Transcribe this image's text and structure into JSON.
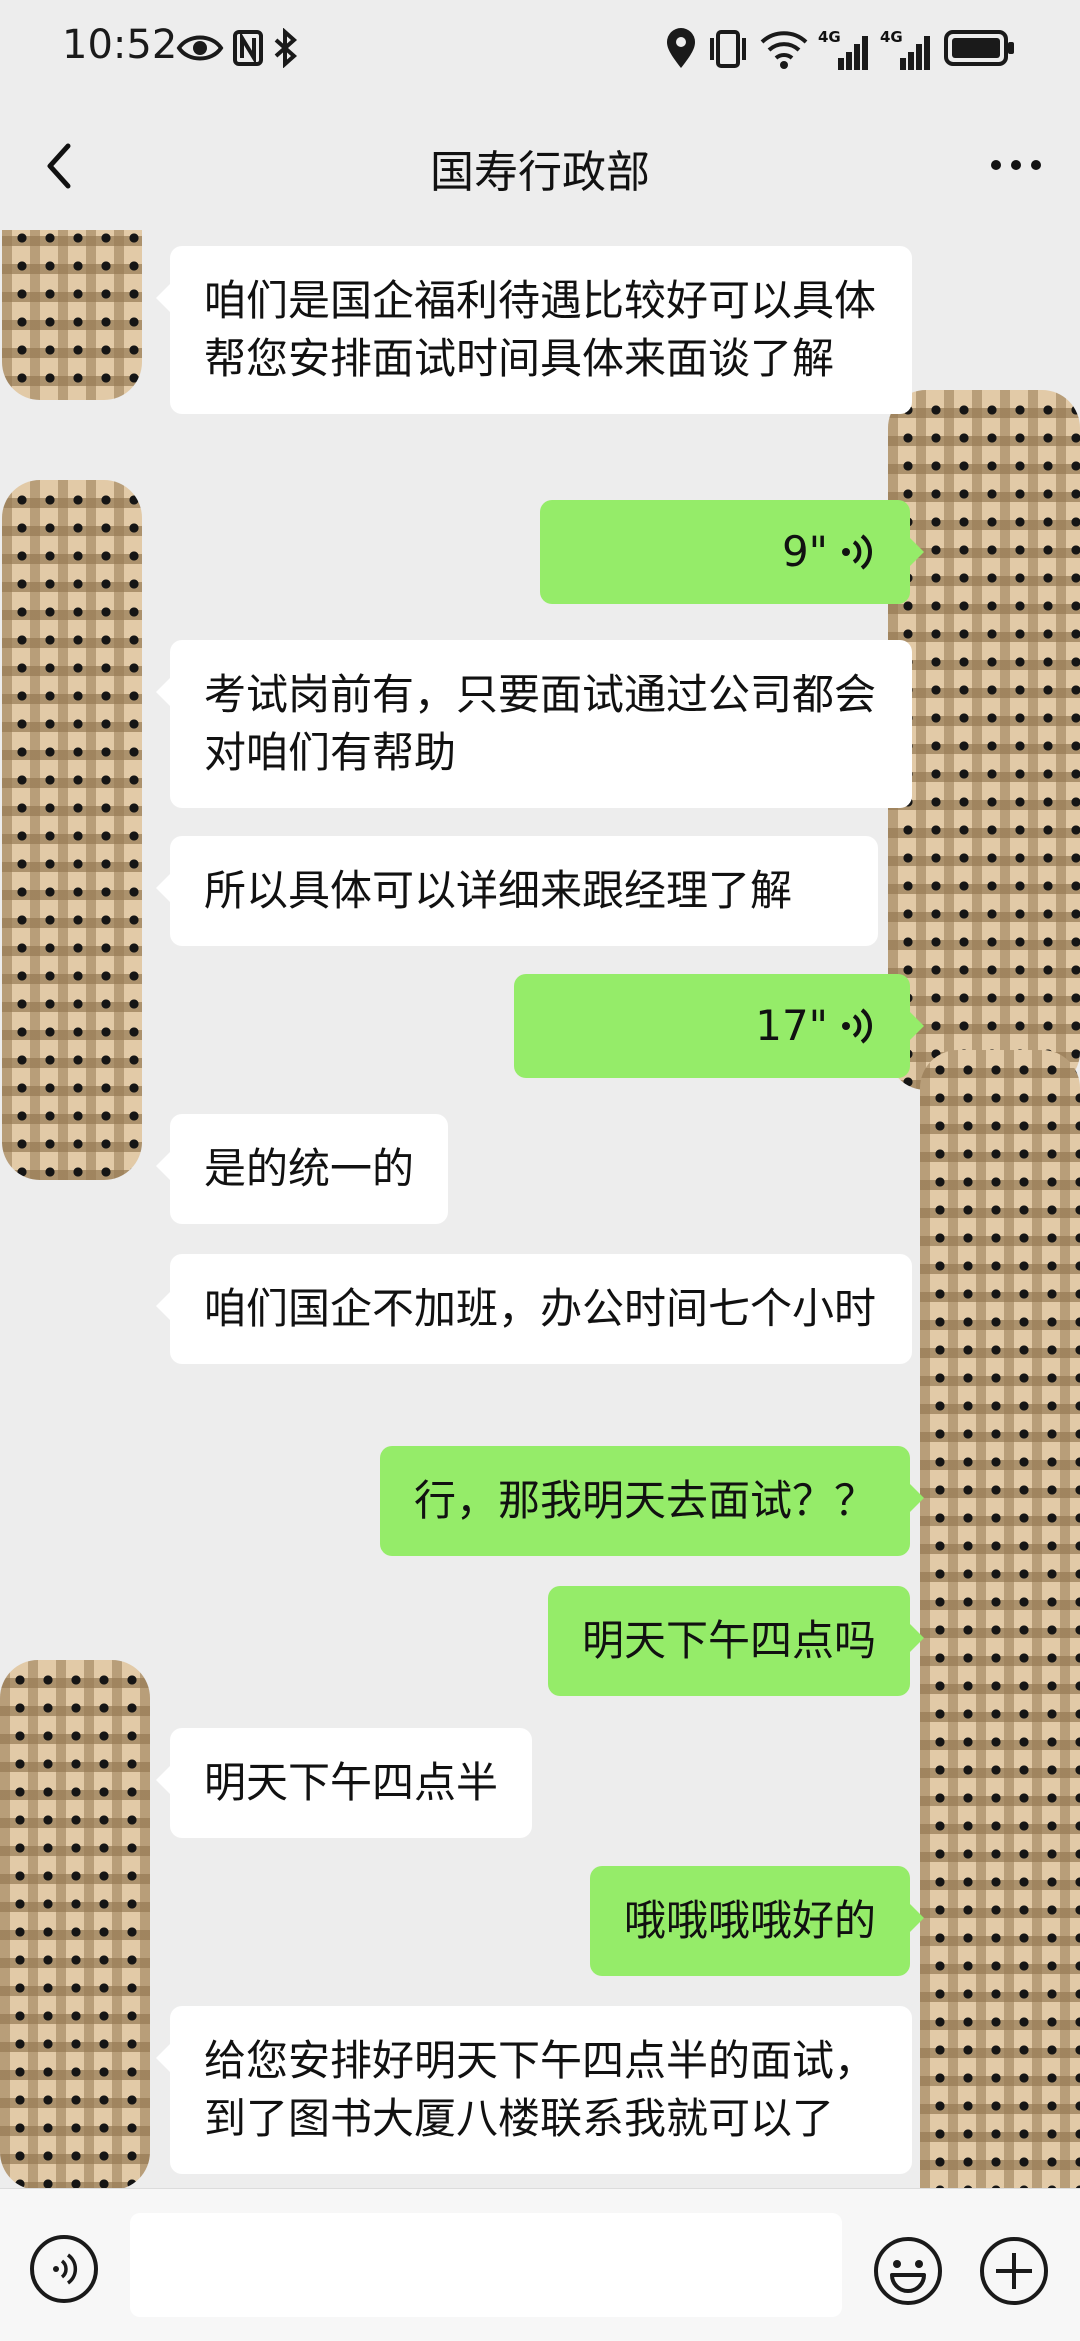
{
  "status_bar": {
    "time": "10:52",
    "left_icons": [
      "eye-icon",
      "nfc-icon",
      "bluetooth-icon"
    ],
    "right_icons": [
      "location-icon",
      "vibrate-icon",
      "wifi-icon",
      "signal-4g-icon",
      "signal-4g-icon",
      "battery-icon"
    ],
    "signal_1_label": "4G",
    "signal_2_label": "4G"
  },
  "header": {
    "title": "国寿行政部",
    "back_icon": "chevron-left-icon",
    "more_icon": "more-dots-icon"
  },
  "messages": [
    {
      "side": "in",
      "text": "咱们是国企福利待遇比较好可以具体帮您安排面试时间具体来面谈了解"
    },
    {
      "side": "out",
      "type": "voice",
      "duration": "9\""
    },
    {
      "side": "in",
      "text": "考试岗前有，只要面试通过公司都会对咱们有帮助"
    },
    {
      "side": "in",
      "text": "所以具体可以详细来跟经理了解"
    },
    {
      "side": "out",
      "type": "voice",
      "duration": "17\""
    },
    {
      "side": "in",
      "text": "是的统一的"
    },
    {
      "side": "in",
      "text": "咱们国企不加班，办公时间七个小时"
    },
    {
      "side": "out",
      "text": "行，那我明天去面试？？"
    },
    {
      "side": "out",
      "text": "明天下午四点吗"
    },
    {
      "side": "in",
      "text": "明天下午四点半"
    },
    {
      "side": "out",
      "text": "哦哦哦哦好的"
    },
    {
      "side": "in",
      "text": "给您安排好明天下午四点半的面试，到了图书大厦八楼联系我就可以了"
    }
  ],
  "input_bar": {
    "voice_icon": "voice-input-icon",
    "input_value": "",
    "emoji_icon": "emoji-icon",
    "plus_icon": "plus-circle-icon"
  },
  "colors": {
    "background": "#ededed",
    "incoming_bubble": "#ffffff",
    "outgoing_bubble": "#95ec69",
    "input_bar": "#f7f7f7"
  }
}
